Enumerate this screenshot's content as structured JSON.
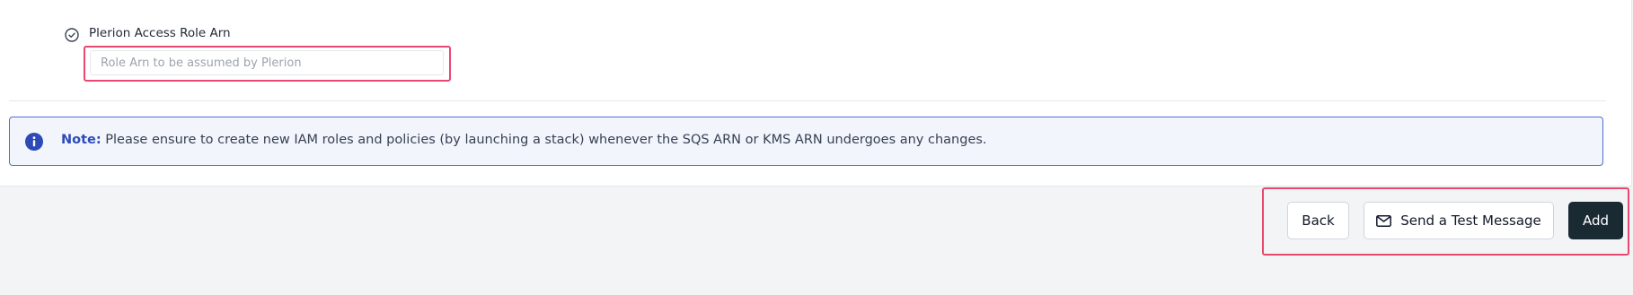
{
  "form": {
    "field_label": "Plerion Access Role Arn",
    "field_placeholder": "Role Arn to be assumed by Plerion",
    "field_value": "",
    "field_status_icon": "check-circle-icon"
  },
  "note": {
    "icon": "info-circle-icon",
    "prefix": "Note:",
    "message": "Please ensure to create new IAM roles and policies (by launching a stack) whenever the SQS ARN or KMS ARN undergoes any changes."
  },
  "actions": {
    "back_label": "Back",
    "test_label": "Send a Test Message",
    "test_icon": "mail-icon",
    "add_label": "Add"
  },
  "colors": {
    "highlight": "#e8486f",
    "note_border": "#4f6fd0",
    "note_background": "#f3f5fd",
    "primary_button": "#1a2a33",
    "info_icon": "#2c4bb7"
  }
}
